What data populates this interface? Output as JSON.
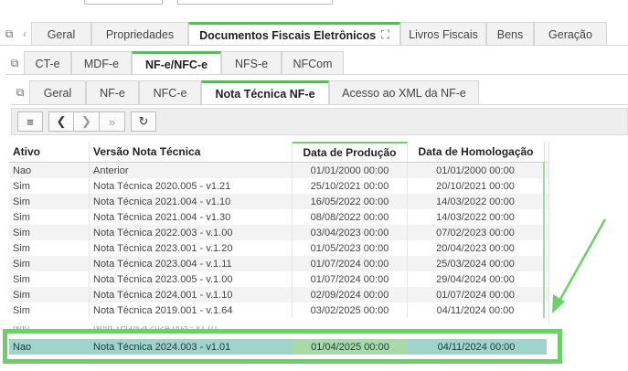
{
  "main_tabs": [
    {
      "label": "Geral"
    },
    {
      "label": "Propriedades"
    },
    {
      "label": "Documentos Fiscais Eletrônicos",
      "active": true
    },
    {
      "label": "Livros Fiscais"
    },
    {
      "label": "Bens"
    },
    {
      "label": "Geração"
    }
  ],
  "doc_tabs": [
    {
      "label": "CT-e"
    },
    {
      "label": "MDF-e"
    },
    {
      "label": "NF-e/NFC-e",
      "active": true
    },
    {
      "label": "NFS-e"
    },
    {
      "label": "NFCom"
    }
  ],
  "sub_tabs": [
    {
      "label": "Geral"
    },
    {
      "label": "NF-e"
    },
    {
      "label": "NFC-e"
    },
    {
      "label": "Nota Técnica NF-e",
      "active": true
    },
    {
      "label": "Acesso ao XML da NF-e"
    }
  ],
  "toolbar": {
    "icons": [
      "list-icon",
      "chevron-left-icon",
      "chevron-right-icon",
      "double-chevron-right-icon",
      "refresh-icon"
    ],
    "glyphs": {
      "list": "≡",
      "prev": "❮",
      "next": "❯",
      "last": "»",
      "refresh": "↻"
    }
  },
  "columns": [
    "Ativo",
    "Versão Nota Técnica",
    "Data de Produção",
    "Data de Homologação"
  ],
  "rows": [
    [
      "Nao",
      "Anterior",
      "01/01/2000 00:00",
      "01/01/2000 00:00"
    ],
    [
      "Sim",
      "Nota Técnica 2020.005 - v1.21",
      "25/10/2021 00:00",
      "20/10/2021 00:00"
    ],
    [
      "Sim",
      "Nota Técnica 2021.004 - v1.10",
      "16/05/2022 00:00",
      "14/03/2022 00:00"
    ],
    [
      "Sim",
      "Nota Técnica 2021.004 - v1.30",
      "08/08/2022 00:00",
      "14/03/2022 00:00"
    ],
    [
      "Sim",
      "Nota Técnica 2022.003 - v.1.00",
      "03/04/2023 00:00",
      "07/02/2023 00:00"
    ],
    [
      "Sim",
      "Nota Técnica 2023.001 - v.1.20",
      "01/05/2023 00:00",
      "20/04/2023 00:00"
    ],
    [
      "Sim",
      "Nota Técnica 2023.004 - v.1.11",
      "01/07/2024 00:00",
      "25/03/2024 00:00"
    ],
    [
      "Sim",
      "Nota Técnica 2023.005 - v.1.00",
      "01/07/2024 00:00",
      "29/04/2024 00:00"
    ],
    [
      "Sim",
      "Nota Técnica 2024.001 - v.1.10",
      "02/09/2024 00:00",
      "01/07/2024 00:00"
    ],
    [
      "Sim",
      "Nota Técnica 2019.001 - v.1.64",
      "03/02/2025 00:00",
      "04/11/2024 00:00"
    ]
  ],
  "selected_row": [
    "Nao",
    "Nota Técnica 2024.003 - v1.01",
    "01/04/2025 00:00",
    "04/11/2024 00:00"
  ],
  "colors": {
    "accent": "#5cb85c",
    "selected": "#9fd3cc",
    "annotation": "#6ccf6c"
  }
}
